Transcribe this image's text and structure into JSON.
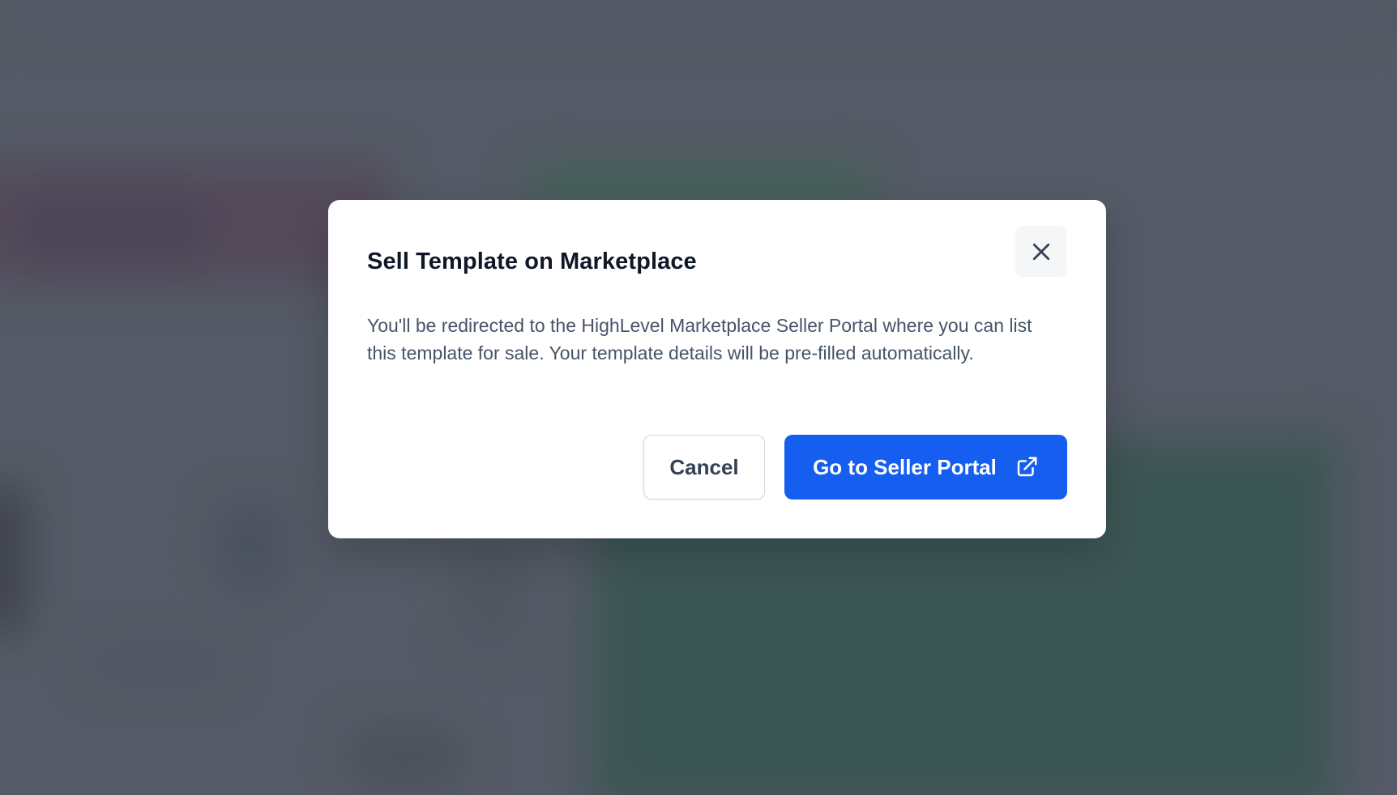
{
  "modal": {
    "title": "Sell Template on Marketplace",
    "body": "You'll be redirected to the HighLevel Marketplace Seller Portal where you can list this template for sale. Your template details will be pre-filled automatically.",
    "close_icon": "close-icon",
    "cancel_label": "Cancel",
    "primary_label": "Go to Seller Portal",
    "primary_icon": "external-link-icon"
  },
  "colors": {
    "primary": "#155eef",
    "title": "#101828",
    "body_text": "#475467",
    "overlay": "#5b606b"
  }
}
